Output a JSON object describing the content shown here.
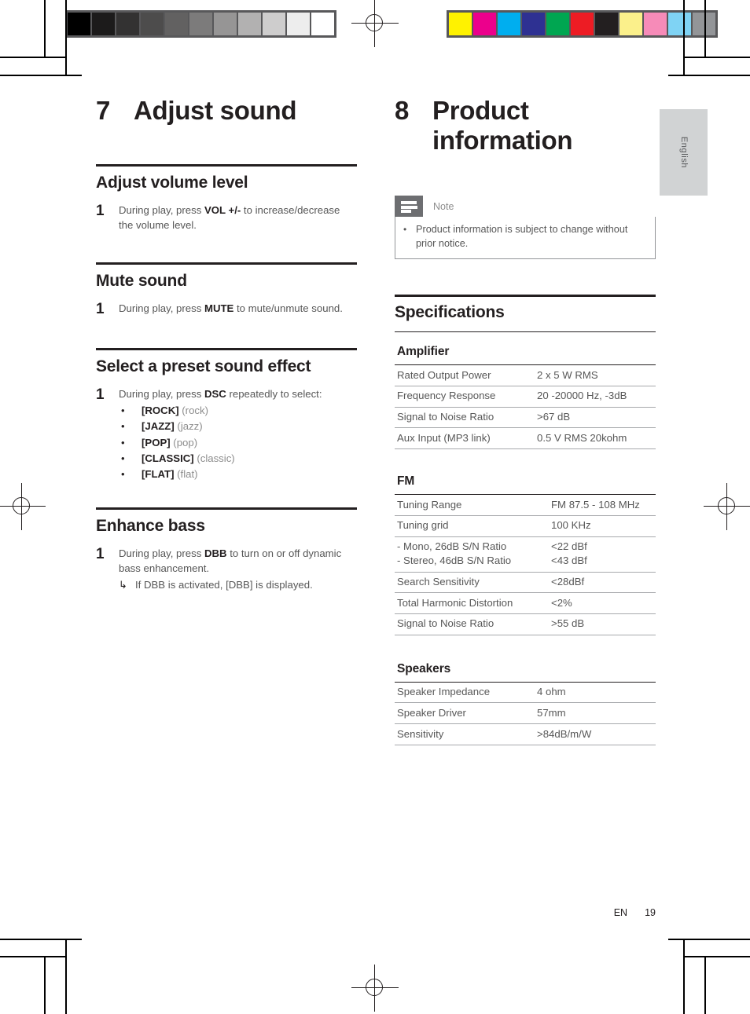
{
  "page": {
    "language_tab": "English",
    "footer_locale": "EN",
    "footer_page_number": "19"
  },
  "calibration": {
    "grayscale_label": "grayscale-calibration-strip",
    "grayscale_patches": [
      "#000000",
      "#1c1b1b",
      "#333232",
      "#4d4c4c",
      "#626161",
      "#7c7b7b",
      "#969595",
      "#b2b1b1",
      "#cecdcd",
      "#ededed",
      "#ffffff"
    ],
    "color_label": "color-calibration-strip",
    "color_patches": [
      "#fff200",
      "#ec008c",
      "#00aeef",
      "#2e3192",
      "#00a651",
      "#ed1c24",
      "#231f20",
      "#fbf08b",
      "#f68bb8",
      "#7fd3f4",
      "#939598"
    ]
  },
  "left_column": {
    "chapter": {
      "number": "7",
      "title": "Adjust sound"
    },
    "sections": [
      {
        "title": "Adjust volume level",
        "steps": [
          {
            "number": "1",
            "text_before": "During play, press ",
            "bold": "VOL +/-",
            "text_after": " to increase/decrease the volume level."
          }
        ]
      },
      {
        "title": "Mute sound",
        "steps": [
          {
            "number": "1",
            "text_before": "During play, press ",
            "bold": "MUTE",
            "text_after": " to mute/unmute sound."
          }
        ]
      },
      {
        "title": "Select a preset sound effect",
        "steps": [
          {
            "number": "1",
            "text_before": "During play, press ",
            "bold": "DSC",
            "text_after": " repeatedly to select:"
          }
        ],
        "bullets": [
          {
            "marker": "•",
            "bold": "[ROCK]",
            "rest": " (rock)"
          },
          {
            "marker": "•",
            "bold": "[JAZZ]",
            "rest": " (jazz)"
          },
          {
            "marker": "•",
            "bold": "[POP]",
            "rest": " (pop)"
          },
          {
            "marker": "•",
            "bold": "[CLASSIC]",
            "rest": " (classic)"
          },
          {
            "marker": "•",
            "bold": "[FLAT]",
            "rest": " (flat)"
          }
        ]
      },
      {
        "title": "Enhance bass",
        "steps": [
          {
            "number": "1",
            "text_before": "During play, press ",
            "bold": "DBB",
            "text_after": " to turn on or off dynamic bass enhancement."
          }
        ],
        "subnote": {
          "arrow": "↳",
          "text": "If DBB is activated, [DBB] is displayed."
        }
      }
    ]
  },
  "right_column": {
    "chapter": {
      "number": "8",
      "title": "Product information"
    },
    "note": {
      "icon": "note-lines-icon",
      "label": "Note",
      "items": [
        {
          "marker": "•",
          "text": "Product information is subject to change without prior notice."
        }
      ]
    },
    "specifications": {
      "title": "Specifications",
      "groups": [
        {
          "name": "Amplifier",
          "rows": [
            {
              "label": "Rated Output Power",
              "value": "2 x 5 W RMS",
              "no_separator": false
            },
            {
              "label": "Frequency Response",
              "value": "20 -20000 Hz, -3dB",
              "no_separator": false
            },
            {
              "label": "Signal to Noise Ratio",
              "value": ">67 dB",
              "no_separator": false
            },
            {
              "label": "Aux Input (MP3 link)",
              "value": "0.5 V RMS 20kohm",
              "no_separator": false
            }
          ]
        },
        {
          "name": "FM",
          "rows": [
            {
              "label": "Tuning Range",
              "value": "FM 87.5 - 108 MHz",
              "no_separator": false
            },
            {
              "label": "Tuning grid",
              "value": "100 KHz",
              "no_separator": false
            },
            {
              "label": " - Mono, 26dB S/N Ratio",
              "value": "<22 dBf",
              "no_separator": true
            },
            {
              "label": " - Stereo, 46dB S/N Ratio",
              "value": "<43 dBf",
              "no_separator": false
            },
            {
              "label": "Search Sensitivity",
              "value": "<28dBf",
              "no_separator": false
            },
            {
              "label": "Total Harmonic Distortion",
              "value": "<2%",
              "no_separator": false
            },
            {
              "label": "Signal to Noise Ratio",
              "value": ">55 dB",
              "no_separator": false
            }
          ]
        },
        {
          "name": "Speakers",
          "rows": [
            {
              "label": "Speaker Impedance",
              "value": "4 ohm",
              "no_separator": false
            },
            {
              "label": "Speaker Driver",
              "value": "57mm",
              "no_separator": false
            },
            {
              "label": "Sensitivity",
              "value": ">84dB/m/W",
              "no_separator": false
            }
          ]
        }
      ]
    }
  }
}
